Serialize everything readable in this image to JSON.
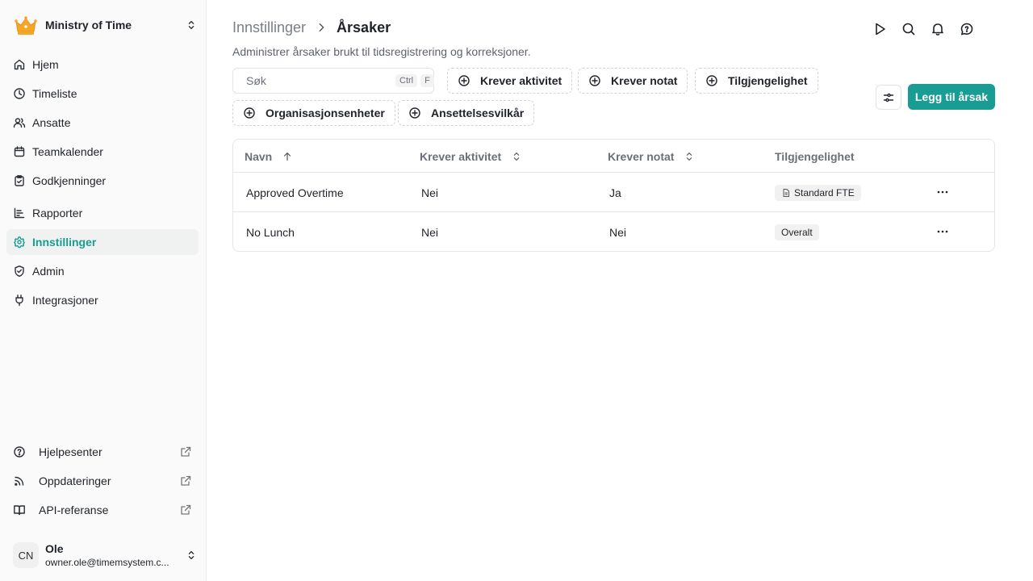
{
  "sidebar": {
    "org_name": "Ministry of Time",
    "nav": [
      {
        "label": "Hjem",
        "icon": "home-icon"
      },
      {
        "label": "Timeliste",
        "icon": "clock-icon"
      },
      {
        "label": "Ansatte",
        "icon": "users-icon"
      },
      {
        "label": "Teamkalender",
        "icon": "calendar-icon"
      },
      {
        "label": "Godkjenninger",
        "icon": "clipboard-check-icon"
      },
      {
        "label": "Rapporter",
        "icon": "chart-icon"
      },
      {
        "label": "Innstillinger",
        "icon": "gear-icon",
        "active": true
      },
      {
        "label": "Admin",
        "icon": "shield-icon"
      },
      {
        "label": "Integrasjoner",
        "icon": "plug-icon"
      }
    ],
    "bottom": [
      {
        "label": "Hjelpesenter",
        "icon": "help-circle-icon"
      },
      {
        "label": "Oppdateringer",
        "icon": "rss-icon"
      },
      {
        "label": "API-referanse",
        "icon": "book-icon"
      }
    ],
    "user": {
      "initials": "CN",
      "name": "Ole",
      "email": "owner.ole@timemsystem.c..."
    }
  },
  "header": {
    "breadcrumb_parent": "Innstillinger",
    "breadcrumb_current": "Årsaker",
    "subtitle": "Administrer årsaker brukt til tidsregistrering og korreksjoner."
  },
  "toolbar": {
    "search_placeholder": "Søk",
    "kbd_ctrl": "Ctrl",
    "kbd_f": "F",
    "filters": [
      "Krever aktivitet",
      "Krever notat",
      "Tilgjengelighet",
      "Organisasjonsenheter",
      "Ansettelsesvilkår"
    ],
    "add_label": "Legg til årsak"
  },
  "table": {
    "columns": [
      "Navn",
      "Krever aktivitet",
      "Krever notat",
      "Tilgjengelighet"
    ],
    "rows": [
      {
        "navn": "Approved Overtime",
        "krever_aktivitet": "Nei",
        "krever_notat": "Ja",
        "tilgjengelighet": "Standard FTE",
        "badge_icon": true
      },
      {
        "navn": "No Lunch",
        "krever_aktivitet": "Nei",
        "krever_notat": "Nei",
        "tilgjengelighet": "Overalt",
        "badge_icon": false
      }
    ]
  },
  "colors": {
    "accent": "#199c93",
    "text": "#1f2329",
    "muted": "#6b7078",
    "crown": "#f5a623"
  }
}
